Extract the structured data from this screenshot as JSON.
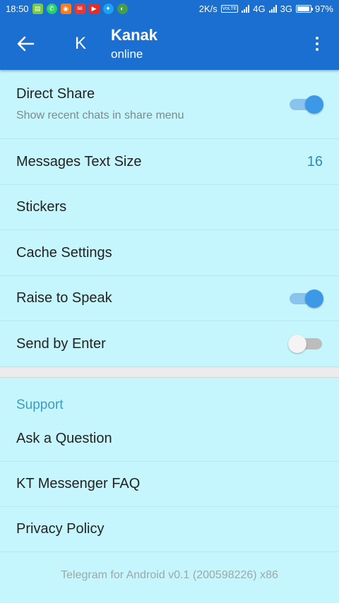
{
  "status_bar": {
    "time": "18:50",
    "net_speed": "2K/s",
    "volte": "VoLTE",
    "network1": "4G",
    "network2": "3G",
    "battery": "97%",
    "battery_level": 0.97,
    "notification_icons": [
      {
        "name": "messages-notification-icon",
        "color": "#7ac943"
      },
      {
        "name": "whatsapp-notification-icon",
        "color": "#25d366"
      },
      {
        "name": "app-notification-icon",
        "color": "#ff7a1a"
      },
      {
        "name": "email-notification-icon",
        "color": "#e53935"
      },
      {
        "name": "youtube-notification-icon",
        "color": "#e52d27"
      },
      {
        "name": "twitter-notification-icon",
        "color": "#1da1f2"
      },
      {
        "name": "browser-notification-icon",
        "color": "#43a047"
      }
    ]
  },
  "app_bar": {
    "background": "#1a6fd1",
    "avatar_letter": "K",
    "chat_name": "Kanak",
    "chat_status": "online"
  },
  "settings": {
    "direct_share": {
      "title": "Direct Share",
      "subtitle": "Show recent chats in share menu",
      "enabled": true
    },
    "text_size": {
      "title": "Messages Text Size",
      "value": "16"
    },
    "stickers": {
      "title": "Stickers"
    },
    "cache": {
      "title": "Cache Settings"
    },
    "raise_to_speak": {
      "title": "Raise to Speak",
      "enabled": true
    },
    "send_by_enter": {
      "title": "Send by Enter",
      "enabled": false
    }
  },
  "support": {
    "header": "Support",
    "ask_question": "Ask a Question",
    "faq": "KT Messenger FAQ",
    "privacy": "Privacy Policy"
  },
  "footer": "Telegram for Android v0.1 (200598226) x86"
}
